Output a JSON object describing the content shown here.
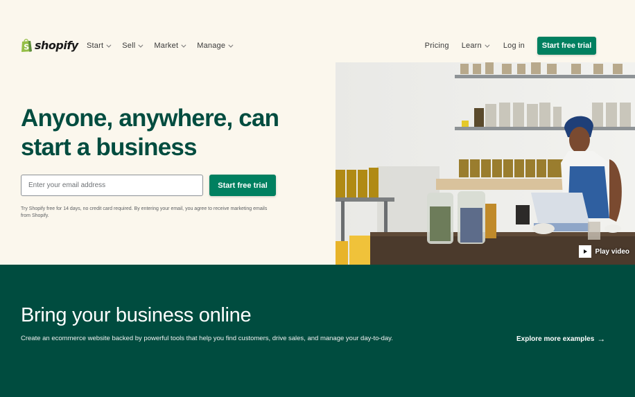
{
  "brand": {
    "name": "shopify",
    "colors": {
      "primary_green": "#008060",
      "dark_green": "#004c3f",
      "logo_green": "#95bf47",
      "background": "#fbf7ed"
    }
  },
  "nav": {
    "left_items": [
      {
        "label": "Start",
        "icon": "chevron-down-icon"
      },
      {
        "label": "Sell",
        "icon": "chevron-down-icon"
      },
      {
        "label": "Market",
        "icon": "chevron-down-icon"
      },
      {
        "label": "Manage",
        "icon": "chevron-down-icon"
      }
    ],
    "pricing": "Pricing",
    "learn": "Learn",
    "login": "Log in",
    "cta": "Start free trial"
  },
  "hero": {
    "title": "Anyone, anywhere, can start a business",
    "email_placeholder": "Enter your email address",
    "cta": "Start free trial",
    "disclaimer": "Try Shopify free for 14 days, no credit card required. By entering your email, you agree to receive marketing emails from Shopify.",
    "play_video": "Play video"
  },
  "band": {
    "title": "Bring your business online",
    "subtitle": "Create an ecommerce website backed by powerful tools that help you find customers, drive sales, and manage your day-to-day.",
    "link": "Explore more examples",
    "link_arrow": "→"
  }
}
